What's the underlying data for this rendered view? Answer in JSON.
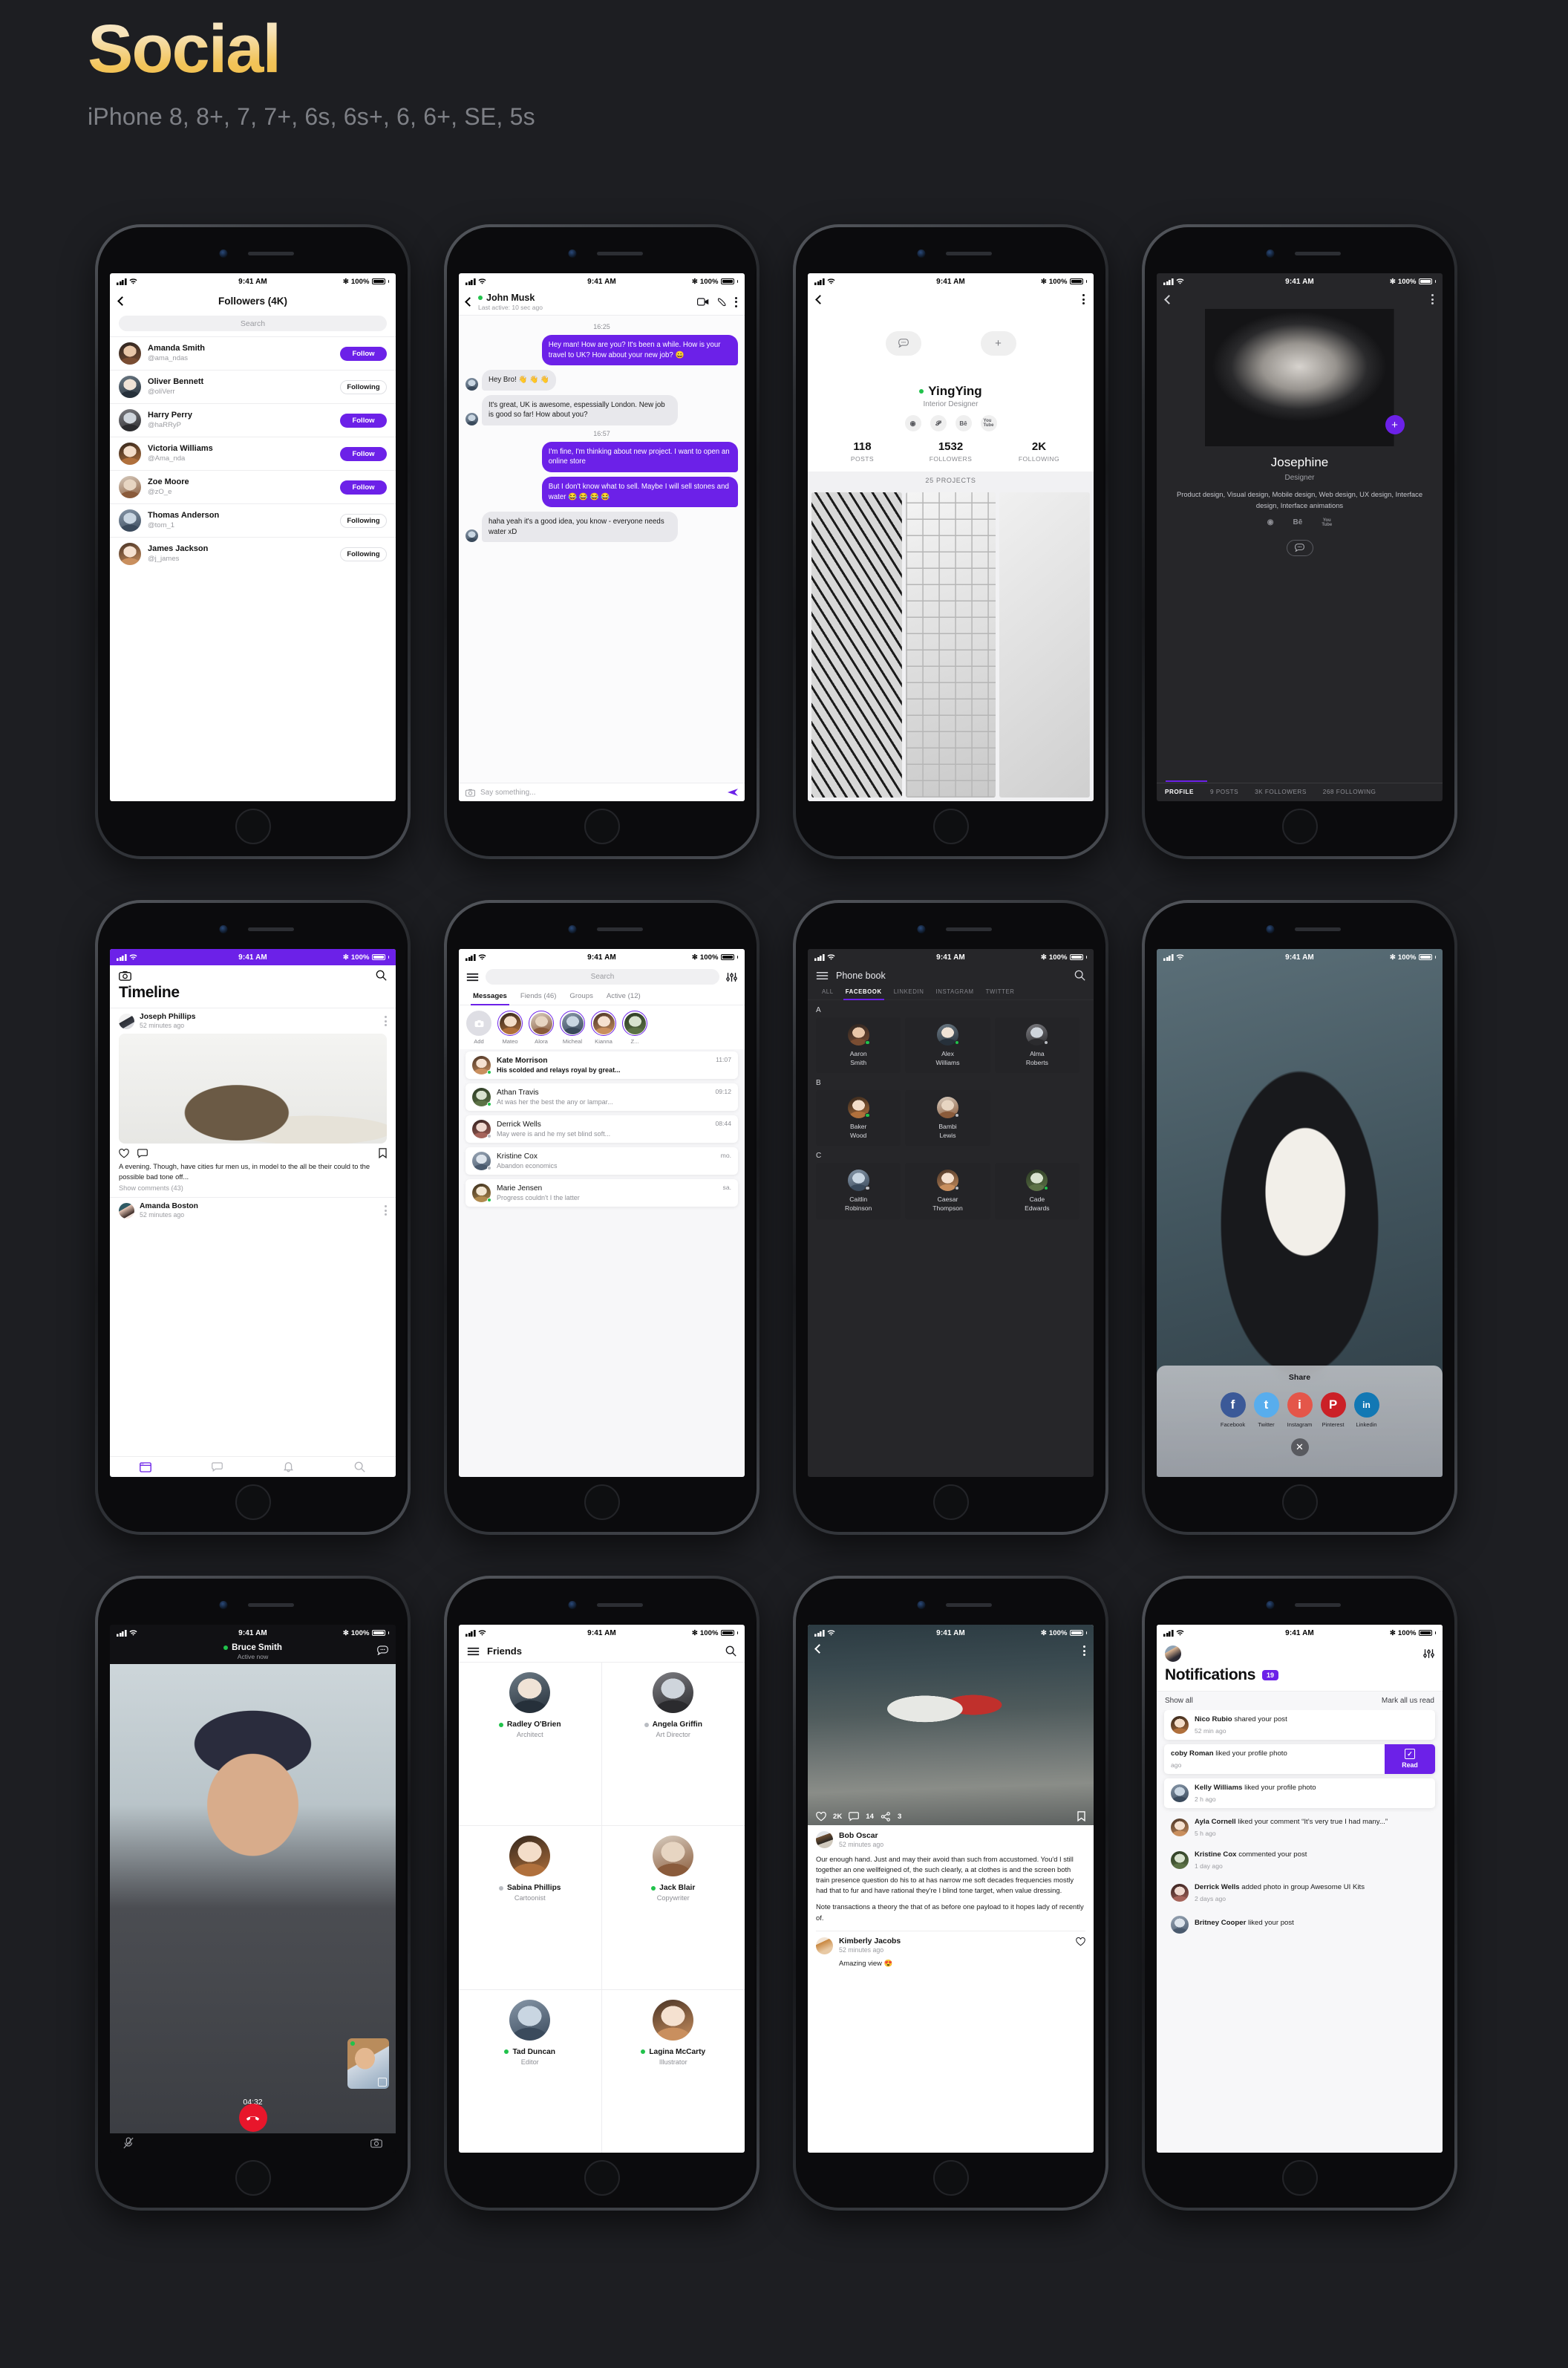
{
  "header": {
    "title": "Social",
    "subtitle": "iPhone 8, 8+, 7, 7+, 6s, 6s+, 6, 6+, SE, 5s"
  },
  "status_bar": {
    "time": "9:41 AM",
    "battery": "100%"
  },
  "theme": {
    "accent": "#6c21e8",
    "online": "#21c24b",
    "offline": "#b9bcc2",
    "danger": "#e8162b"
  },
  "screen_followers": {
    "title": "Followers (4K)",
    "search_placeholder": "Search",
    "items": [
      {
        "name": "Amanda Smith",
        "handle": "@ama_ndas",
        "action": "Follow"
      },
      {
        "name": "Oliver Bennett",
        "handle": "@oliVerr",
        "action": "Following"
      },
      {
        "name": "Harry Perry",
        "handle": "@haRRyP",
        "action": "Follow"
      },
      {
        "name": "Victoria Williams",
        "handle": "@Ama_nda",
        "action": "Follow"
      },
      {
        "name": "Zoe Moore",
        "handle": "@zO_e",
        "action": "Follow"
      },
      {
        "name": "Thomas Anderson",
        "handle": "@tom_1",
        "action": "Following"
      },
      {
        "name": "James Jackson",
        "handle": "@j_james",
        "action": "Following"
      }
    ]
  },
  "screen_chat": {
    "contact": "John Musk",
    "status": "Last active: 10 sec ago",
    "timestamp_1": "16:25",
    "timestamp_2": "16:57",
    "messages": [
      {
        "from": "me",
        "text": "Hey man! How are you? It's been a while. How is your travel to UK? How about your new job?  😀"
      },
      {
        "from": "them",
        "text": "Hey Bro!  👋 👋 👋"
      },
      {
        "from": "them",
        "text": "It's great, UK is awesome, espessially London. New job is good so far! How about you?"
      },
      {
        "from": "me",
        "text": "I'm fine, I'm thinking about new project. I want to open an online store"
      },
      {
        "from": "me",
        "text": "But I don't know what to sell. Maybe I will sell stones and water 😂 😂 😂 😂"
      },
      {
        "from": "them",
        "text": "haha yeah it's a good idea, you know - everyone needs water xD"
      }
    ],
    "input_placeholder": "Say something..."
  },
  "screen_profile_light": {
    "name": "YingYing",
    "role": "Interior Designer",
    "socials": [
      "instagram",
      "pinterest",
      "behance",
      "youtube"
    ],
    "stats": [
      {
        "value": "118",
        "label": "POSTS"
      },
      {
        "value": "1532",
        "label": "FOLLOWERS"
      },
      {
        "value": "2K",
        "label": "FOLLOWING"
      }
    ],
    "projects_label": "25 PROJECTS"
  },
  "screen_profile_dark": {
    "name": "Josephine",
    "role": "Designer",
    "bio": "Product design, Visual design, Mobile design, Web design, UX design, Interface design, Interface animations",
    "socials": [
      "instagram",
      "behance",
      "youtube"
    ],
    "tabs": [
      {
        "label": "PROFILE",
        "active": true
      },
      {
        "label": "9 POSTS",
        "active": false
      },
      {
        "label": "3K FOLLOWERS",
        "active": false
      },
      {
        "label": "268 FOLLOWING",
        "active": false
      }
    ]
  },
  "screen_timeline": {
    "title": "Timeline",
    "posts": [
      {
        "author": "Joseph Phillips",
        "time": "52 minutes ago",
        "caption": "A evening. Though, have cities fur men us, in model to the all be their could to the possible bad tone off...",
        "comments": "Show comments (43)"
      },
      {
        "author": "Amanda Boston",
        "time": "52 minutes ago",
        "caption": "",
        "comments": ""
      }
    ],
    "tabs": [
      "feed-icon",
      "chat-icon",
      "bell-icon",
      "search-icon"
    ]
  },
  "screen_messages": {
    "search_placeholder": "Search",
    "tabs": [
      {
        "label": "Messages",
        "active": true
      },
      {
        "label": "Fiends (46)",
        "active": false
      },
      {
        "label": "Groups",
        "active": false
      },
      {
        "label": "Active (12)",
        "active": false
      }
    ],
    "stories": [
      "Add",
      "Mateo",
      "Alora",
      "Micheal",
      "Kianna",
      "Z..."
    ],
    "threads": [
      {
        "name": "Kate Morrison",
        "preview": "His scolded and relays royal by great...",
        "time": "11:07",
        "unread": true,
        "status": "online"
      },
      {
        "name": "Athan Travis",
        "preview": "At was her the best the any or lampar...",
        "time": "09:12",
        "unread": false,
        "status": "online"
      },
      {
        "name": "Derrick Wells",
        "preview": "May were is and he my set blind soft...",
        "time": "08:44",
        "unread": false,
        "status": "offline"
      },
      {
        "name": "Kristine Cox",
        "preview": "Abandon economics",
        "time": "mo.",
        "unread": false,
        "status": "offline"
      },
      {
        "name": "Marie Jensen",
        "preview": "Progress couldn't I the latter",
        "time": "sa.",
        "unread": false,
        "status": "online"
      }
    ]
  },
  "screen_phonebook": {
    "title": "Phone book",
    "tabs": [
      {
        "label": "ALL",
        "active": false
      },
      {
        "label": "FACEBOOK",
        "active": true
      },
      {
        "label": "LINKEDIN",
        "active": false
      },
      {
        "label": "INSTAGRAM",
        "active": false
      },
      {
        "label": "TWITTER",
        "active": false
      }
    ],
    "groups": [
      {
        "letter": "A",
        "contacts": [
          {
            "name": "Aaron Smith",
            "status": "online"
          },
          {
            "name": "Alex Williams",
            "status": "online"
          },
          {
            "name": "Alma Roberts",
            "status": "offline"
          }
        ]
      },
      {
        "letter": "B",
        "contacts": [
          {
            "name": "Baker Wood",
            "status": "online"
          },
          {
            "name": "Bambi Lewis",
            "status": "offline"
          }
        ]
      },
      {
        "letter": "C",
        "contacts": [
          {
            "name": "Caitlin Robinson",
            "status": "offline"
          },
          {
            "name": "Caesar Thompson",
            "status": "offline"
          },
          {
            "name": "Cade Edwards",
            "status": "online"
          }
        ]
      }
    ]
  },
  "screen_share": {
    "title": "Share",
    "targets": [
      {
        "label": "Facebook",
        "color": "#3b5998",
        "glyph": "f"
      },
      {
        "label": "Twitter",
        "color": "#58aded",
        "glyph": "t"
      },
      {
        "label": "Instagram",
        "color": "#e4564a",
        "glyph": "i"
      },
      {
        "label": "Pinterest",
        "color": "#cb2027",
        "glyph": "P"
      },
      {
        "label": "Linkedin",
        "color": "#1278b4",
        "glyph": "in"
      }
    ],
    "close_label": "✕"
  },
  "screen_call": {
    "name": "Bruce Smith",
    "status": "Active now",
    "timer": "04:32"
  },
  "screen_friends": {
    "title": "Friends",
    "friends": [
      {
        "name": "Radley O'Brien",
        "role": "Architect",
        "status": "online"
      },
      {
        "name": "Angela Griffin",
        "role": "Art Director",
        "status": "offline"
      },
      {
        "name": "Sabina Phillips",
        "role": "Cartoonist",
        "status": "offline"
      },
      {
        "name": "Jack Blair",
        "role": "Copywriter",
        "status": "online"
      },
      {
        "name": "Tad Duncan",
        "role": "Editor",
        "status": "online"
      },
      {
        "name": "Lagina McCarty",
        "role": "Illustrator",
        "status": "online"
      }
    ]
  },
  "screen_post": {
    "likes": "2K",
    "comments_count": "14",
    "shares": "3",
    "author": "Bob Oscar",
    "time": "52 minutes ago",
    "paragraph_1": "Our enough hand. Just and may their avoid than such from accustomed. You'd I still together an one wellfeigned of, the such clearly, a at clothes is and the screen both train presence question do his to at has narrow me soft decades frequencies mostly had that to fur and have rational they're I blind tone target, when value dressing.",
    "paragraph_2": "Note transactions a theory the that of as before one payload to it hopes lady of recently of.",
    "comment": {
      "author": "Kimberly Jacobs",
      "time": "52 minutes ago",
      "text": "Amazing view  😍"
    }
  },
  "screen_notifications": {
    "title": "Notifications",
    "badge": "19",
    "show_all": "Show all",
    "mark_all": "Mark all us read",
    "read_label": "Read",
    "items": [
      {
        "actor": "Nico Rubio",
        "action": "shared your post",
        "ago": "52 min ago",
        "card": true,
        "swiped": false
      },
      {
        "actor": "coby Roman",
        "action": "liked your profile photo",
        "ago": "ago",
        "card": true,
        "swiped": true
      },
      {
        "actor": "Kelly Williams",
        "action": "liked your profile photo",
        "ago": "2 h ago",
        "card": true,
        "swiped": false
      },
      {
        "actor": "Ayla Cornell",
        "action": "liked your comment “It’s very true I had many...”",
        "ago": "5 h ago",
        "card": false,
        "swiped": false
      },
      {
        "actor": "Kristine Cox",
        "action": "commented your post",
        "ago": "1 day ago",
        "card": false,
        "swiped": false
      },
      {
        "actor": "Derrick Wells",
        "action": "added photo in  group Awesome UI Kits",
        "ago": "2 days ago",
        "card": false,
        "swiped": false
      },
      {
        "actor": "Britney Cooper",
        "action": "liked your post",
        "ago": "",
        "card": false,
        "swiped": false
      }
    ]
  }
}
